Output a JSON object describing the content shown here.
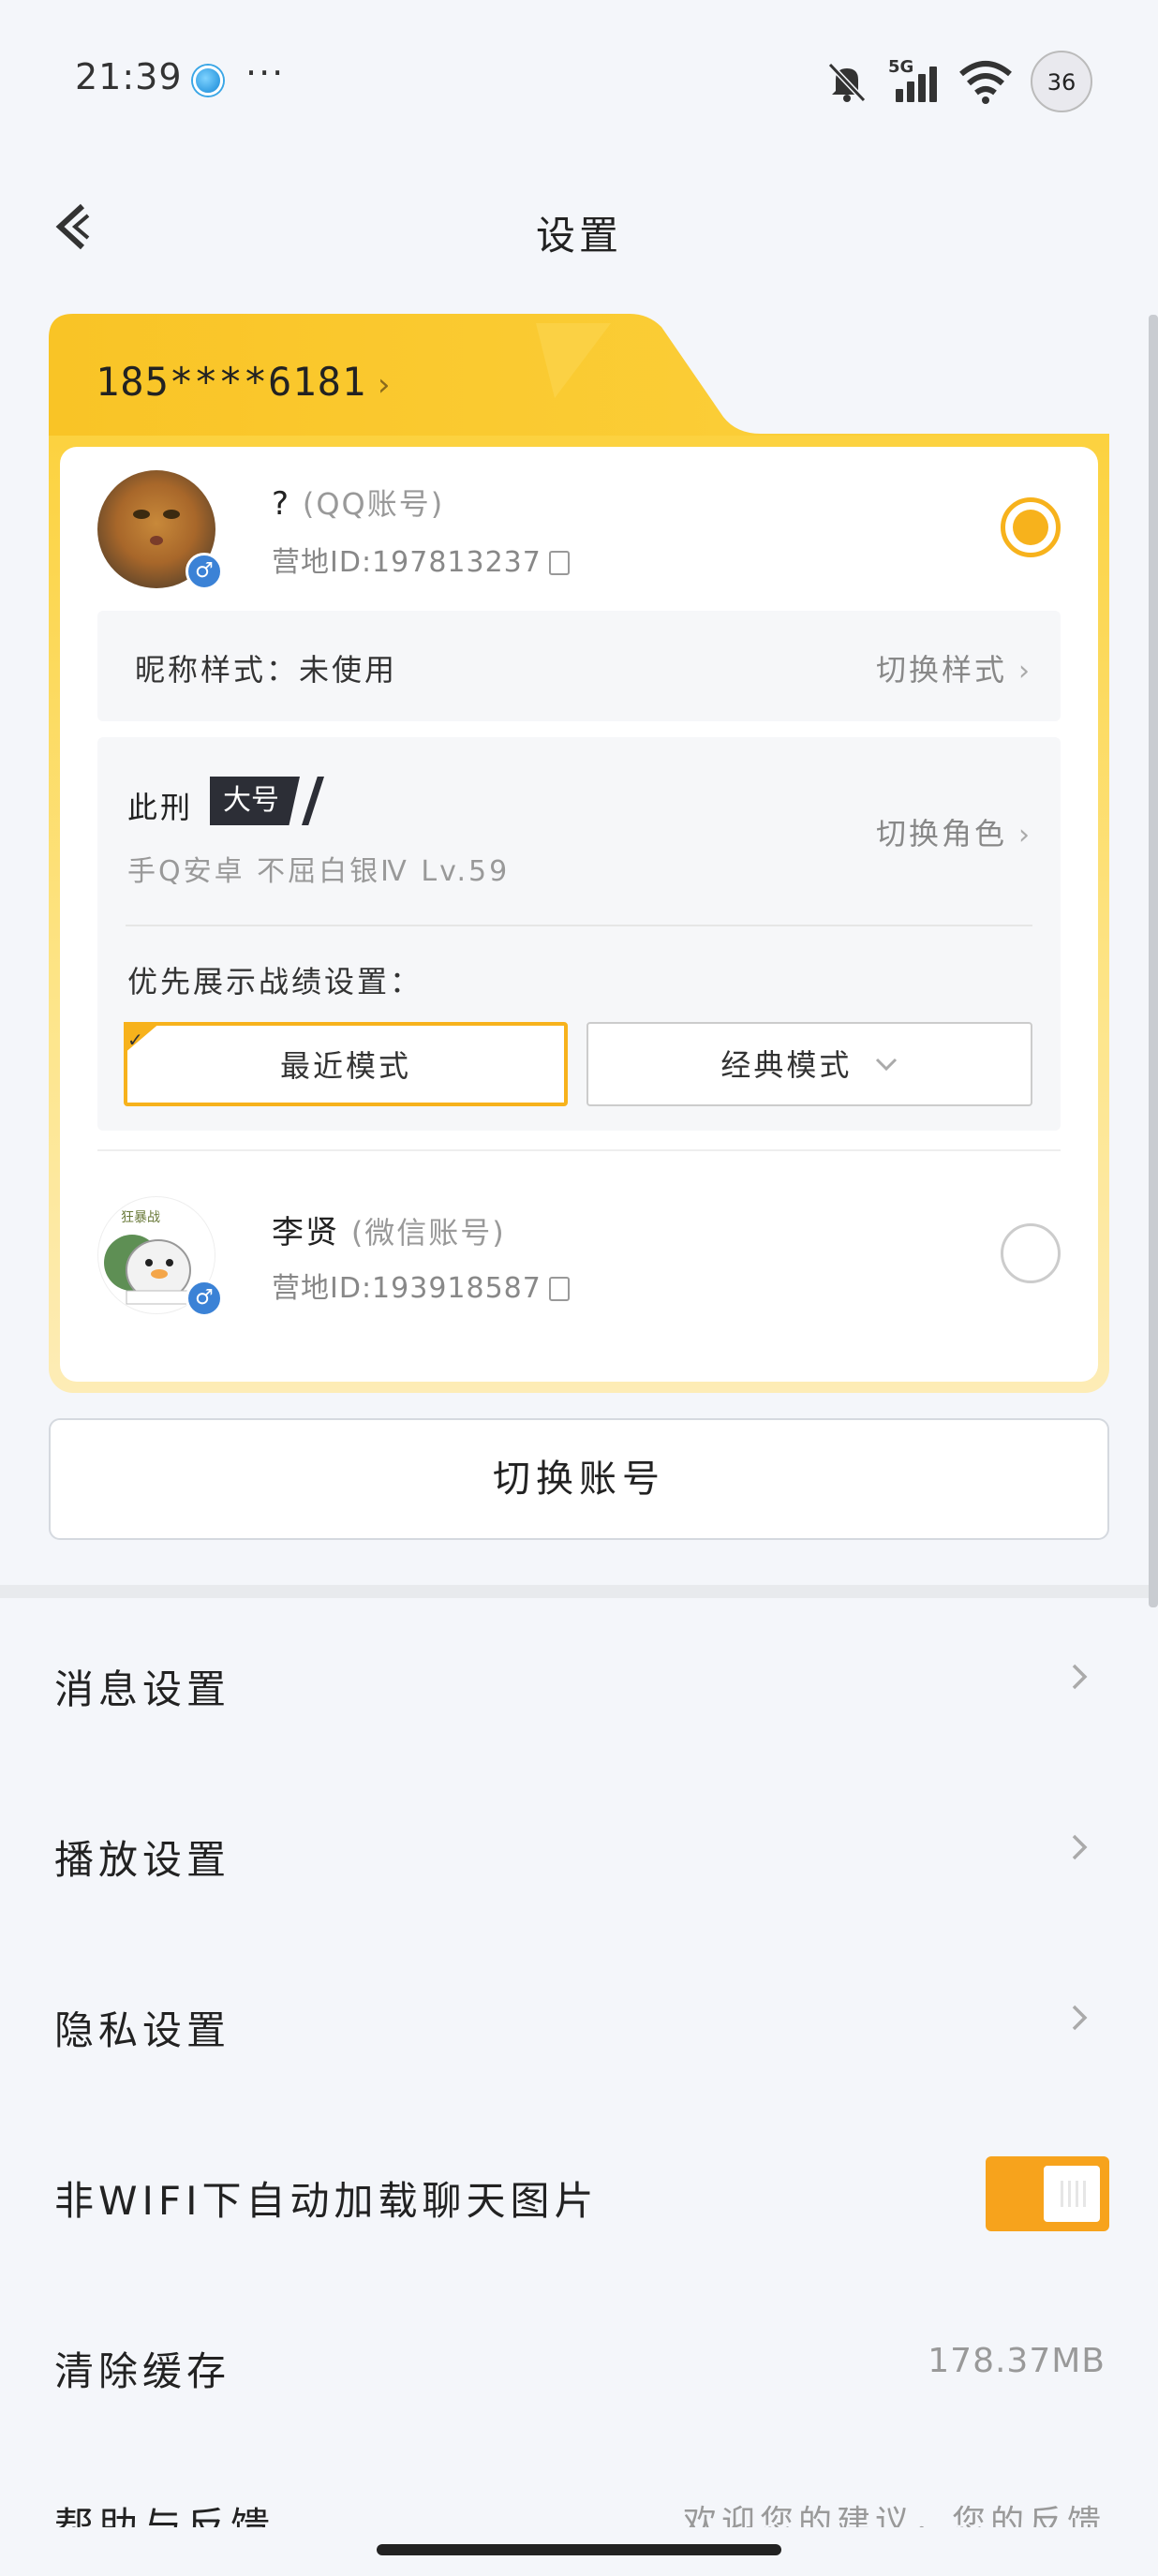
{
  "status_bar": {
    "time": "21:39",
    "dots": "···",
    "network": "5G",
    "battery": "36"
  },
  "header": {
    "title": "设置"
  },
  "account_card": {
    "phone": "185****6181",
    "accounts": [
      {
        "name": "?",
        "type": "(QQ账号)",
        "camp_id": "营地ID:197813237",
        "selected": true
      },
      {
        "name": "李贤",
        "type": "(微信账号)",
        "camp_id": "营地ID:193918587",
        "selected": false
      }
    ],
    "nickname_style": {
      "label": "昵称样式：未使用",
      "switch_label": "切换样式"
    },
    "role": {
      "name": "此刑",
      "tag": "大号",
      "detail": "手Q安卓 不屈白银Ⅳ Lv.59",
      "switch_label": "切换角色",
      "pref_label": "优先展示战绩设置：",
      "modes": [
        "最近模式",
        "经典模式"
      ],
      "selected_mode": "最近模式"
    },
    "avatar2_caption": "狂暴战"
  },
  "switch_account_button": "切换账号",
  "settings": [
    {
      "label": "消息设置",
      "kind": "link"
    },
    {
      "label": "播放设置",
      "kind": "link"
    },
    {
      "label": "隐私设置",
      "kind": "link"
    },
    {
      "label": "非WIFI下自动加载聊天图片",
      "kind": "toggle",
      "on": true
    },
    {
      "label": "清除缓存",
      "kind": "value",
      "value": "178.37MB"
    }
  ],
  "partial_row": {
    "label": "帮助与反馈",
    "value": "欢迎您的建议，您的反馈"
  },
  "colors": {
    "accent": "#f7b21c",
    "card_gradient_top": "#fcd23f",
    "toggle_on": "#f7a31c"
  }
}
